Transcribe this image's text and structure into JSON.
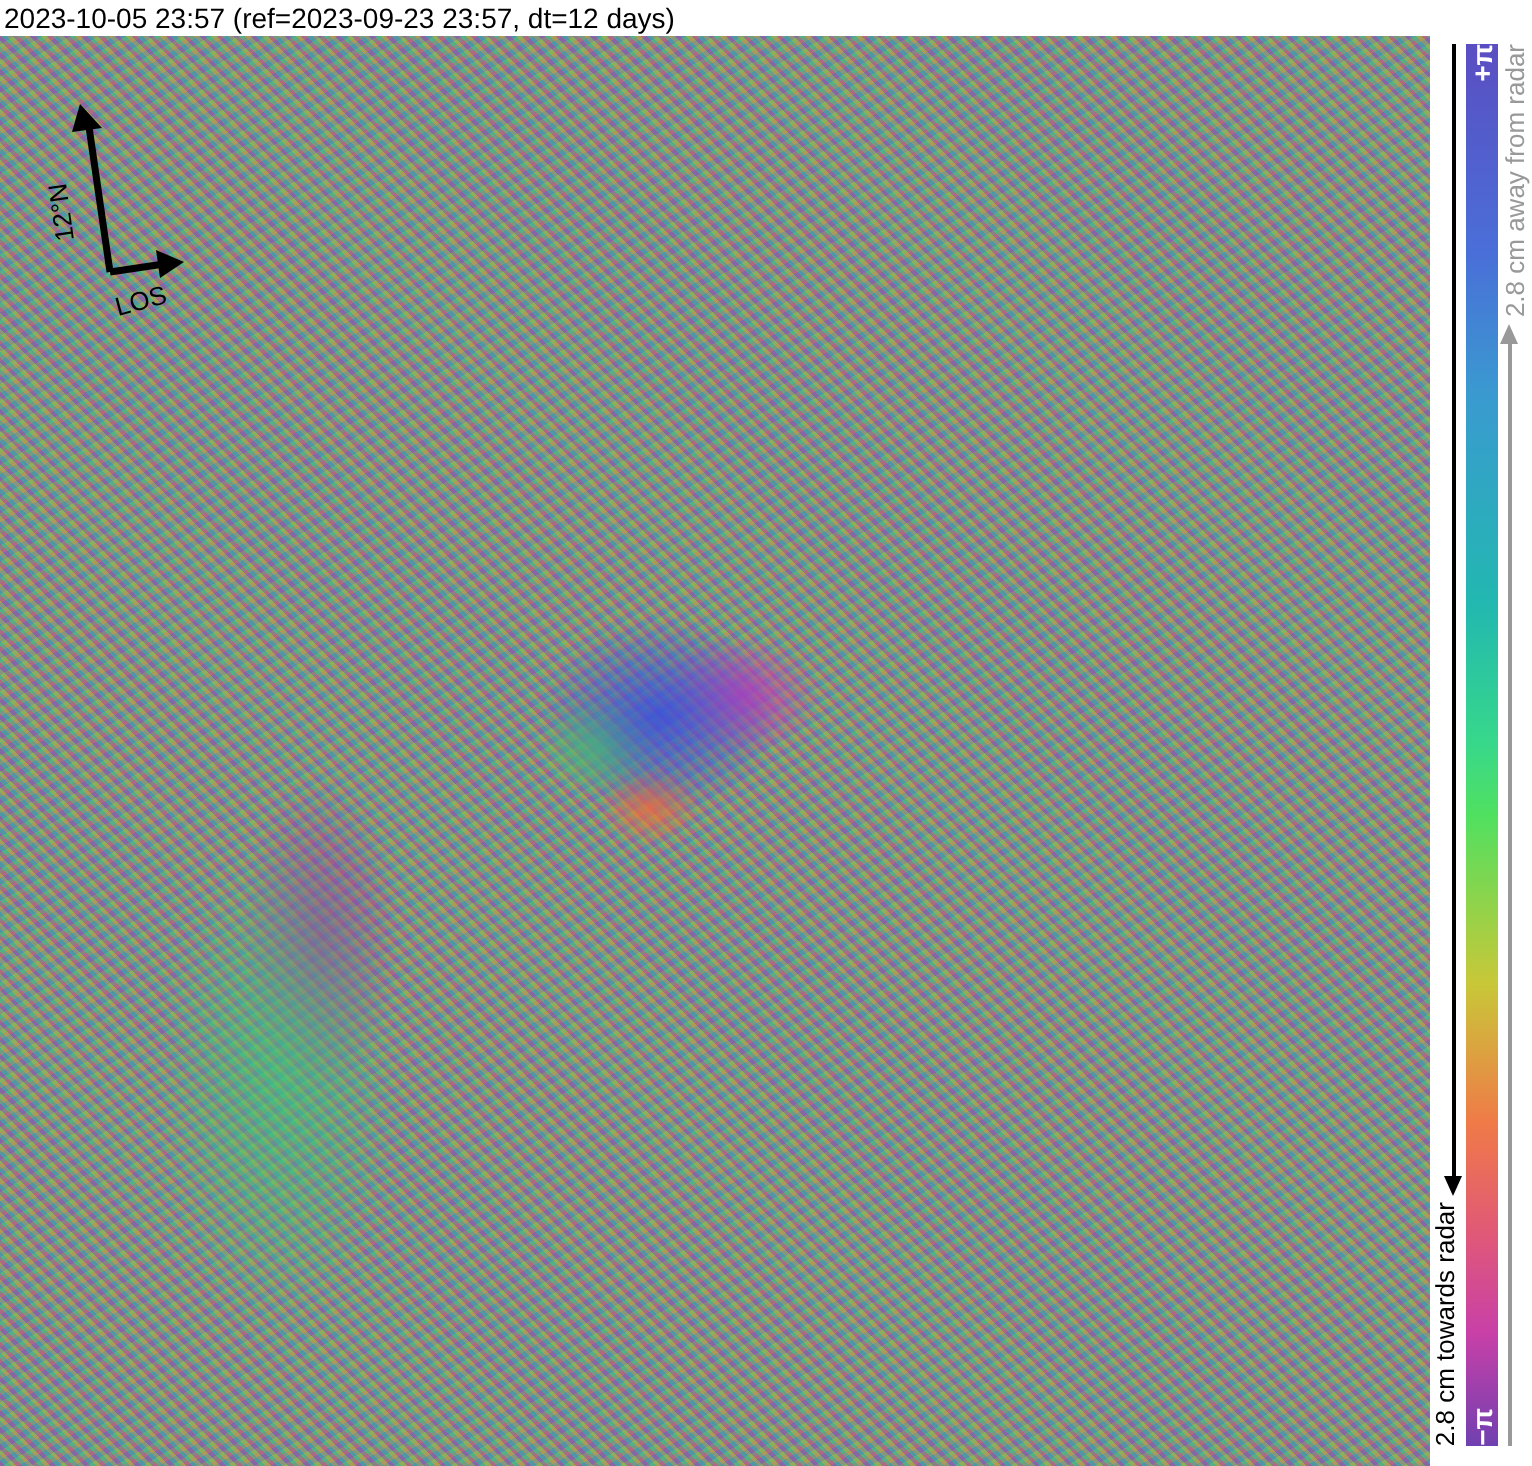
{
  "title": "2023-10-05 23:57 (ref=2023-09-23 23:57, dt=12 days)",
  "compass": {
    "north_label": "12°N",
    "los_label": "LOS"
  },
  "colorbar": {
    "max_label": "+π",
    "min_label": "−π",
    "upper_caption": "2.8 cm away from radar",
    "lower_caption": "2.8 cm towards radar"
  }
}
